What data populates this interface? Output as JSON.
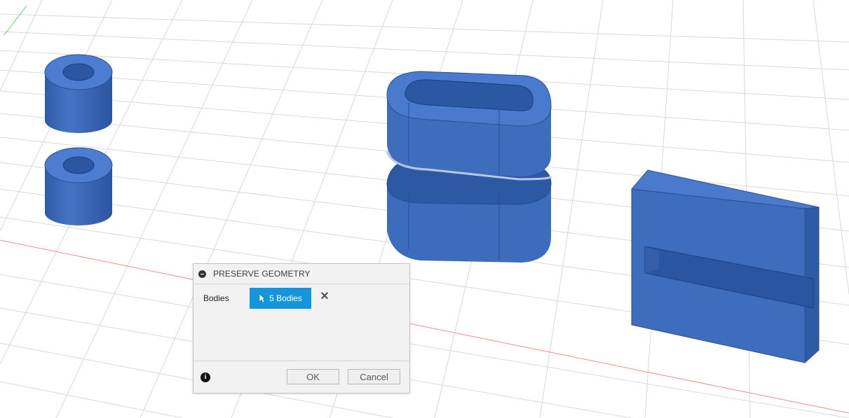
{
  "dialog": {
    "title": "PRESERVE GEOMETRY",
    "bodies_label": "Bodies",
    "selection_label": "5 Bodies",
    "ok_label": "OK",
    "cancel_label": "Cancel"
  },
  "colors": {
    "body_blue": "#3f6fbd",
    "selection_blue": "#1596dc",
    "grid": "#d5d5d5",
    "x_axis_red": "#f08080",
    "y_axis_green": "#5ecb5e"
  }
}
